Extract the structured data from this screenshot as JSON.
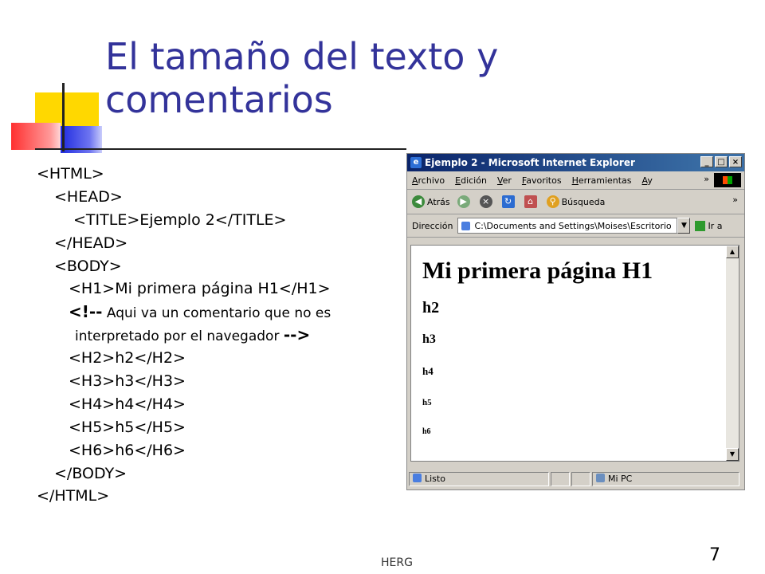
{
  "slide": {
    "title_line1": "El tamaño del texto y",
    "title_line2": "comentarios",
    "footer": "HERG",
    "page_number": "7"
  },
  "code": [
    "<HTML>",
    "  <HEAD>",
    "    <TITLE>Ejemplo 2</TITLE>",
    "  </HEAD>",
    "  <BODY>",
    "    <H1>Mi primera página H1</H1>"
  ],
  "comment": {
    "open": "<!--",
    "line1_rest": " Aqui va un comentario que no es",
    "line2": "interpretado por el navegador ",
    "close": "-->"
  },
  "code_after": [
    "<H2>h2</H2>",
    "<H3>h3</H3>",
    "<H4>h4</H4>",
    "<H5>h5</H5>",
    "<H6>h6</H6>",
    "</BODY>",
    "</HTML>"
  ],
  "browser": {
    "window_title": "Ejemplo 2 - Microsoft Internet Explorer",
    "window_buttons": {
      "minimize": "_",
      "maximize": "□",
      "close": "×"
    },
    "menu": [
      "Archivo",
      "Edición",
      "Ver",
      "Favoritos",
      "Herramientas",
      "Ay"
    ],
    "menu_overflow": "»",
    "toolbar": {
      "back": "Atrás",
      "search": "Búsqueda",
      "overflow": "»"
    },
    "address": {
      "label": "Dirección",
      "value": "C:\\Documents and Settings\\Moises\\Escritorio",
      "go": "Ir a"
    },
    "page": {
      "h1": "Mi primera página H1",
      "h2": "h2",
      "h3": "h3",
      "h4": "h4",
      "h5": "h5",
      "h6": "h6"
    },
    "status": {
      "text": "Listo",
      "zone": "Mi PC"
    }
  }
}
